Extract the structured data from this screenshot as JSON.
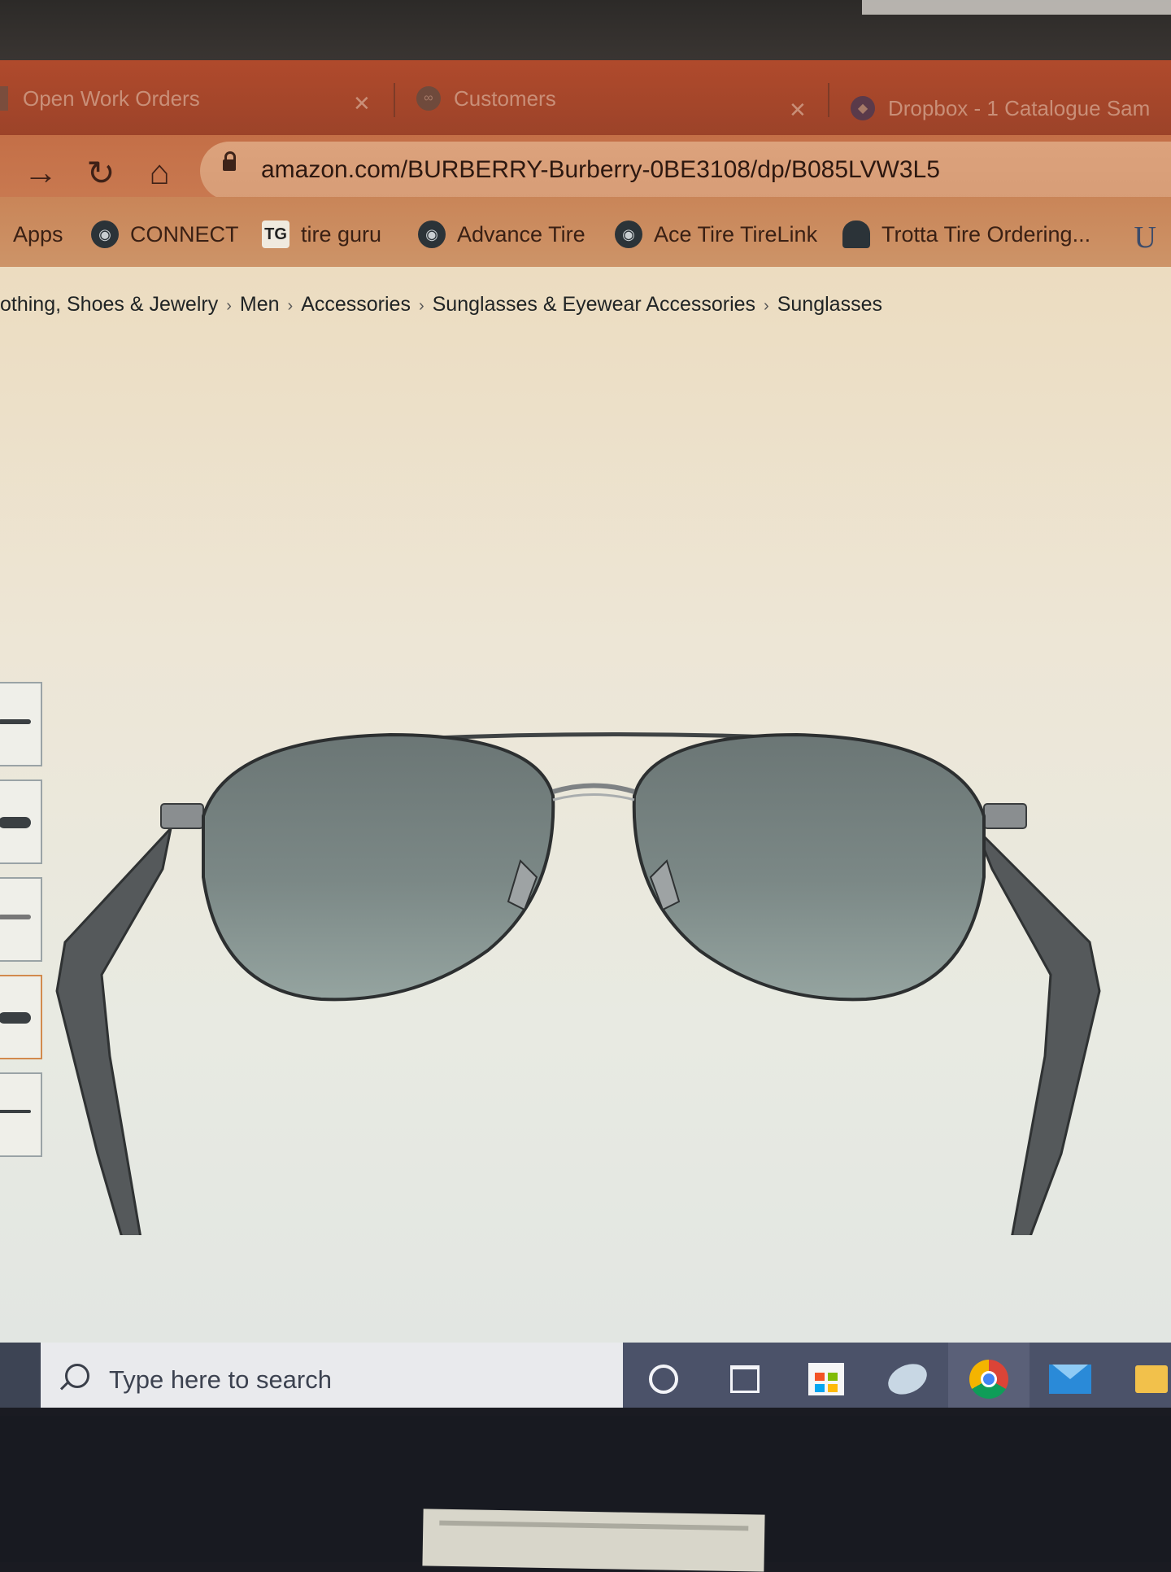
{
  "browser": {
    "tabs": [
      {
        "label": "Open Work Orders"
      },
      {
        "label": "Customers"
      },
      {
        "label": "Dropbox - 1 Catalogue Sam"
      }
    ],
    "url": "amazon.com/BURBERRY-Burberry-0BE3108/dp/B085LVW3L5"
  },
  "bookmarks": {
    "apps": "Apps",
    "items": [
      {
        "label": "CONNECT",
        "icon": "globe-icon"
      },
      {
        "label": "tire guru",
        "icon": "tg-icon"
      },
      {
        "label": "Advance Tire",
        "icon": "globe-icon"
      },
      {
        "label": "Ace Tire TireLink",
        "icon": "globe-icon"
      },
      {
        "label": "Trotta Tire Ordering...",
        "icon": "bookmark-icon"
      }
    ],
    "overflow": "U"
  },
  "breadcrumb": {
    "items": [
      "othing, Shoes & Jewelry",
      "Men",
      "Accessories",
      "Sunglasses & Eyewear Accessories",
      "Sunglasses"
    ],
    "separator": "›"
  },
  "taskbar": {
    "search_placeholder": "Type here to search",
    "apps": [
      "cortana-icon",
      "task-view-icon",
      "store-icon",
      "snip-icon",
      "chrome-icon",
      "mail-icon",
      "file-explorer-icon"
    ]
  },
  "colors": {
    "tab_strip": "#b04a2c",
    "address_bar": "#c46f47",
    "taskbar_tray": "#4b5269",
    "lens": "#6f7d7a"
  }
}
